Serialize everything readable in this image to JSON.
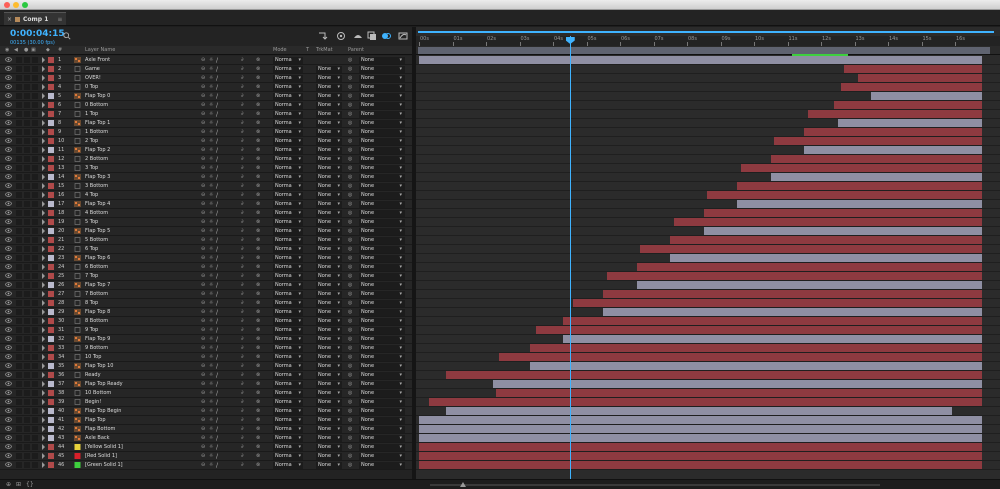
{
  "window": {
    "tab_label": "Comp 1",
    "tab_menu": "≡",
    "tab_close": "×"
  },
  "composition": {
    "timecode": "0:00:04:15",
    "frames_fps": "00135 (30.00 fps)"
  },
  "columns": {
    "hash": "#",
    "layer_name": "Layer Name",
    "mode": "Mode",
    "t": "T",
    "trkmat": "TrkMat",
    "parent": "Parent"
  },
  "ruler": {
    "ticks": [
      "00s",
      "01s",
      "02s",
      "03s",
      "04s",
      "05s",
      "06s",
      "07s",
      "08s",
      "09s",
      "10s",
      "11s",
      "12s",
      "13s",
      "14s",
      "15s",
      "16s"
    ]
  },
  "time": {
    "current_seconds": 4.5,
    "duration_seconds": 16.8
  },
  "layer_colors": {
    "red": "#8e3a40",
    "lavender": "#8f8fa3",
    "yellow_solid": "#e8d23c",
    "red_solid": "#d8202a",
    "green_solid": "#3ecf3e"
  },
  "layers": [
    {
      "num": "1",
      "name": "Axle Front",
      "icon": "composition",
      "mode": "Norma",
      "trkmat": "",
      "parent": "None",
      "label": "#b04a4a",
      "bar": "lavender",
      "in": 0,
      "out": 16.8
    },
    {
      "num": "2",
      "name": "Game",
      "icon": "footage",
      "mode": "Norma",
      "trkmat": "None",
      "parent": "None",
      "label": "#b04a4a",
      "bar": "red",
      "in": 12.7,
      "out": 16.8
    },
    {
      "num": "3",
      "name": "OVER!",
      "icon": "footage",
      "mode": "Norma",
      "trkmat": "None",
      "parent": "None",
      "label": "#b04a4a",
      "bar": "red",
      "in": 13.1,
      "out": 16.8
    },
    {
      "num": "4",
      "name": "0 Top",
      "icon": "footage",
      "mode": "Norma",
      "trkmat": "None",
      "parent": "None",
      "label": "#b04a4a",
      "bar": "red",
      "in": 12.6,
      "out": 16.8
    },
    {
      "num": "5",
      "name": "Flap Top 0",
      "icon": "composition",
      "mode": "Norma",
      "trkmat": "None",
      "parent": "None",
      "label": "#b9b9cc",
      "bar": "lavender",
      "in": 13.5,
      "out": 16.8
    },
    {
      "num": "6",
      "name": "0 Bottom",
      "icon": "footage",
      "mode": "Norma",
      "trkmat": "None",
      "parent": "None",
      "label": "#b04a4a",
      "bar": "red",
      "in": 12.4,
      "out": 16.8
    },
    {
      "num": "7",
      "name": "1 Top",
      "icon": "footage",
      "mode": "Norma",
      "trkmat": "None",
      "parent": "None",
      "label": "#b04a4a",
      "bar": "red",
      "in": 11.6,
      "out": 16.8
    },
    {
      "num": "8",
      "name": "Flap Top 1",
      "icon": "composition",
      "mode": "Norma",
      "trkmat": "None",
      "parent": "None",
      "label": "#b9b9cc",
      "bar": "lavender",
      "in": 12.5,
      "out": 16.8
    },
    {
      "num": "9",
      "name": "1 Bottom",
      "icon": "footage",
      "mode": "Norma",
      "trkmat": "None",
      "parent": "None",
      "label": "#b04a4a",
      "bar": "red",
      "in": 11.5,
      "out": 16.8
    },
    {
      "num": "10",
      "name": "2 Top",
      "icon": "footage",
      "mode": "Norma",
      "trkmat": "None",
      "parent": "None",
      "label": "#b04a4a",
      "bar": "red",
      "in": 10.6,
      "out": 16.8
    },
    {
      "num": "11",
      "name": "Flap Top 2",
      "icon": "composition",
      "mode": "Norma",
      "trkmat": "None",
      "parent": "None",
      "label": "#b9b9cc",
      "bar": "lavender",
      "in": 11.5,
      "out": 16.8
    },
    {
      "num": "12",
      "name": "2 Bottom",
      "icon": "footage",
      "mode": "Norma",
      "trkmat": "None",
      "parent": "None",
      "label": "#b04a4a",
      "bar": "red",
      "in": 10.5,
      "out": 16.8
    },
    {
      "num": "13",
      "name": "3 Top",
      "icon": "footage",
      "mode": "Norma",
      "trkmat": "None",
      "parent": "None",
      "label": "#b04a4a",
      "bar": "red",
      "in": 9.6,
      "out": 16.8
    },
    {
      "num": "14",
      "name": "Flap Top 3",
      "icon": "composition",
      "mode": "Norma",
      "trkmat": "None",
      "parent": "None",
      "label": "#b9b9cc",
      "bar": "lavender",
      "in": 10.5,
      "out": 16.8
    },
    {
      "num": "15",
      "name": "3 Bottom",
      "icon": "footage",
      "mode": "Norma",
      "trkmat": "None",
      "parent": "None",
      "label": "#b04a4a",
      "bar": "red",
      "in": 9.5,
      "out": 16.8
    },
    {
      "num": "16",
      "name": "4 Top",
      "icon": "footage",
      "mode": "Norma",
      "trkmat": "None",
      "parent": "None",
      "label": "#b04a4a",
      "bar": "red",
      "in": 8.6,
      "out": 16.8
    },
    {
      "num": "17",
      "name": "Flap Top 4",
      "icon": "composition",
      "mode": "Norma",
      "trkmat": "None",
      "parent": "None",
      "label": "#b9b9cc",
      "bar": "lavender",
      "in": 9.5,
      "out": 16.8
    },
    {
      "num": "18",
      "name": "4 Bottom",
      "icon": "footage",
      "mode": "Norma",
      "trkmat": "None",
      "parent": "None",
      "label": "#b04a4a",
      "bar": "red",
      "in": 8.5,
      "out": 16.8
    },
    {
      "num": "19",
      "name": "5 Top",
      "icon": "footage",
      "mode": "Norma",
      "trkmat": "None",
      "parent": "None",
      "label": "#b04a4a",
      "bar": "red",
      "in": 7.6,
      "out": 16.8
    },
    {
      "num": "20",
      "name": "Flap Top 5",
      "icon": "composition",
      "mode": "Norma",
      "trkmat": "None",
      "parent": "None",
      "label": "#b9b9cc",
      "bar": "lavender",
      "in": 8.5,
      "out": 16.8
    },
    {
      "num": "21",
      "name": "5 Bottom",
      "icon": "footage",
      "mode": "Norma",
      "trkmat": "None",
      "parent": "None",
      "label": "#b04a4a",
      "bar": "red",
      "in": 7.5,
      "out": 16.8
    },
    {
      "num": "22",
      "name": "6 Top",
      "icon": "footage",
      "mode": "Norma",
      "trkmat": "None",
      "parent": "None",
      "label": "#b04a4a",
      "bar": "red",
      "in": 6.6,
      "out": 16.8
    },
    {
      "num": "23",
      "name": "Flap Top 6",
      "icon": "composition",
      "mode": "Norma",
      "trkmat": "None",
      "parent": "None",
      "label": "#b9b9cc",
      "bar": "lavender",
      "in": 7.5,
      "out": 16.8
    },
    {
      "num": "24",
      "name": "6 Bottom",
      "icon": "footage",
      "mode": "Norma",
      "trkmat": "None",
      "parent": "None",
      "label": "#b04a4a",
      "bar": "red",
      "in": 6.5,
      "out": 16.8
    },
    {
      "num": "25",
      "name": "7 Top",
      "icon": "footage",
      "mode": "Norma",
      "trkmat": "None",
      "parent": "None",
      "label": "#b04a4a",
      "bar": "red",
      "in": 5.6,
      "out": 16.8
    },
    {
      "num": "26",
      "name": "Flap Top 7",
      "icon": "composition",
      "mode": "Norma",
      "trkmat": "None",
      "parent": "None",
      "label": "#b9b9cc",
      "bar": "lavender",
      "in": 6.5,
      "out": 16.8
    },
    {
      "num": "27",
      "name": "7 Bottom",
      "icon": "footage",
      "mode": "Norma",
      "trkmat": "None",
      "parent": "None",
      "label": "#b04a4a",
      "bar": "red",
      "in": 5.5,
      "out": 16.8
    },
    {
      "num": "28",
      "name": "8 Top",
      "icon": "footage",
      "mode": "Norma",
      "trkmat": "None",
      "parent": "None",
      "label": "#b04a4a",
      "bar": "red",
      "in": 4.6,
      "out": 16.8
    },
    {
      "num": "29",
      "name": "Flap Top 8",
      "icon": "composition",
      "mode": "Norma",
      "trkmat": "None",
      "parent": "None",
      "label": "#b9b9cc",
      "bar": "lavender",
      "in": 5.5,
      "out": 16.8
    },
    {
      "num": "30",
      "name": "8 Bottom",
      "icon": "footage",
      "mode": "Norma",
      "trkmat": "None",
      "parent": "None",
      "label": "#b04a4a",
      "bar": "red",
      "in": 4.3,
      "out": 16.8
    },
    {
      "num": "31",
      "name": "9 Top",
      "icon": "footage",
      "mode": "Norma",
      "trkmat": "None",
      "parent": "None",
      "label": "#b04a4a",
      "bar": "red",
      "in": 3.5,
      "out": 16.8
    },
    {
      "num": "32",
      "name": "Flap Top 9",
      "icon": "composition",
      "mode": "Norma",
      "trkmat": "None",
      "parent": "None",
      "label": "#b9b9cc",
      "bar": "lavender",
      "in": 4.3,
      "out": 16.8
    },
    {
      "num": "33",
      "name": "9 Bottom",
      "icon": "footage",
      "mode": "Norma",
      "trkmat": "None",
      "parent": "None",
      "label": "#b04a4a",
      "bar": "red",
      "in": 3.3,
      "out": 16.8
    },
    {
      "num": "34",
      "name": "10 Top",
      "icon": "footage",
      "mode": "Norma",
      "trkmat": "None",
      "parent": "None",
      "label": "#b04a4a",
      "bar": "red",
      "in": 2.4,
      "out": 16.8
    },
    {
      "num": "35",
      "name": "Flap Top 10",
      "icon": "composition",
      "mode": "Norma",
      "trkmat": "None",
      "parent": "None",
      "label": "#b9b9cc",
      "bar": "lavender",
      "in": 3.3,
      "out": 16.8
    },
    {
      "num": "36",
      "name": "Ready",
      "icon": "footage",
      "mode": "Norma",
      "trkmat": "None",
      "parent": "None",
      "label": "#b04a4a",
      "bar": "red",
      "in": 0.8,
      "out": 16.8
    },
    {
      "num": "37",
      "name": "Flap Top Ready",
      "icon": "composition",
      "mode": "Norma",
      "trkmat": "None",
      "parent": "None",
      "label": "#b9b9cc",
      "bar": "lavender",
      "in": 2.2,
      "out": 16.8
    },
    {
      "num": "38",
      "name": "10 Bottom",
      "icon": "footage",
      "mode": "Norma",
      "trkmat": "None",
      "parent": "None",
      "label": "#b04a4a",
      "bar": "red",
      "in": 2.3,
      "out": 16.8
    },
    {
      "num": "39",
      "name": "Begin!",
      "icon": "footage",
      "mode": "Norma",
      "trkmat": "None",
      "parent": "None",
      "label": "#b04a4a",
      "bar": "red",
      "in": 0.3,
      "out": 16.8
    },
    {
      "num": "40",
      "name": "Flap Top Begin",
      "icon": "composition",
      "mode": "Norma",
      "trkmat": "None",
      "parent": "None",
      "label": "#b9b9cc",
      "bar": "lavender",
      "in": 0.8,
      "out": 15.9
    },
    {
      "num": "41",
      "name": "Flap Top",
      "icon": "composition",
      "mode": "Norma",
      "trkmat": "None",
      "parent": "None",
      "label": "#b9b9cc",
      "bar": "lavender",
      "in": 0,
      "out": 16.8
    },
    {
      "num": "42",
      "name": "Flap Bottom",
      "icon": "composition",
      "mode": "Norma",
      "trkmat": "None",
      "parent": "None",
      "label": "#b9b9cc",
      "bar": "lavender",
      "in": 0,
      "out": 16.8
    },
    {
      "num": "43",
      "name": "Axle Back",
      "icon": "composition",
      "mode": "Norma",
      "trkmat": "None",
      "parent": "None",
      "label": "#b9b9cc",
      "bar": "lavender",
      "in": 0,
      "out": 16.8
    },
    {
      "num": "44",
      "name": "[Yellow Solid 1]",
      "icon": "solid-yellow",
      "mode": "Norma",
      "trkmat": "None",
      "parent": "None",
      "label": "#b04a4a",
      "bar": "red",
      "in": 0,
      "out": 16.8
    },
    {
      "num": "45",
      "name": "[Red Solid 1]",
      "icon": "solid-red",
      "mode": "Norma",
      "trkmat": "None",
      "parent": "None",
      "label": "#b04a4a",
      "bar": "red",
      "in": 0,
      "out": 16.8
    },
    {
      "num": "46",
      "name": "[Green Solid 1]",
      "icon": "solid-green",
      "mode": "Norma",
      "trkmat": "None",
      "parent": "None",
      "label": "#b04a4a",
      "bar": "red",
      "in": 0,
      "out": 16.8
    }
  ]
}
